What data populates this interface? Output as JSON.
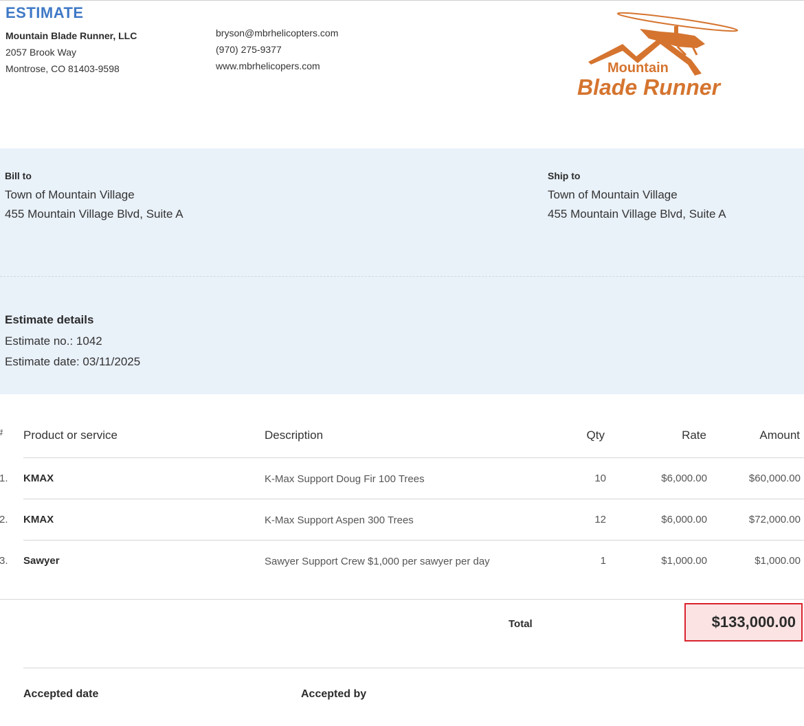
{
  "header": {
    "title": "ESTIMATE",
    "company_name": "Mountain Blade Runner, LLC",
    "address_line1": "2057 Brook Way",
    "address_line2": "Montrose, CO 81403-9598",
    "email": "bryson@mbrhelicopters.com",
    "phone": "(970) 275-9377",
    "website": "www.mbrhelicopers.com"
  },
  "logo": {
    "line1": "Mountain",
    "line2": "Blade Runner",
    "color": "#d5742f"
  },
  "bill_to": {
    "label": "Bill to",
    "name": "Town of Mountain Village",
    "address": "455 Mountain Village Blvd, Suite A"
  },
  "ship_to": {
    "label": "Ship to",
    "name": "Town of Mountain Village",
    "address": "455 Mountain Village Blvd, Suite A"
  },
  "estimate_details": {
    "label": "Estimate details",
    "number": "Estimate no.: 1042",
    "date": "Estimate date: 03/11/2025"
  },
  "table": {
    "headers": {
      "num": "#",
      "product": "Product or service",
      "description": "Description",
      "qty": "Qty",
      "rate": "Rate",
      "amount": "Amount"
    },
    "rows": [
      {
        "num": "1.",
        "product": "KMAX",
        "description": "K-Max Support Doug Fir 100 Trees",
        "qty": "10",
        "rate": "$6,000.00",
        "amount": "$60,000.00"
      },
      {
        "num": "2.",
        "product": "KMAX",
        "description": "K-Max Support Aspen 300 Trees",
        "qty": "12",
        "rate": "$6,000.00",
        "amount": "$72,000.00"
      },
      {
        "num": "3.",
        "product": "Sawyer",
        "description": "Sawyer Support Crew $1,000 per sawyer per day",
        "qty": "1",
        "rate": "$1,000.00",
        "amount": "$1,000.00"
      }
    ]
  },
  "total": {
    "label": "Total",
    "value": "$133,000.00"
  },
  "acceptance": {
    "date_label": "Accepted date",
    "by_label": "Accepted by"
  },
  "colors": {
    "title_blue": "#3f79c6",
    "band_bg": "#e9f1f9",
    "highlight_border": "#d9232d",
    "highlight_bg": "#fbe3e3"
  }
}
